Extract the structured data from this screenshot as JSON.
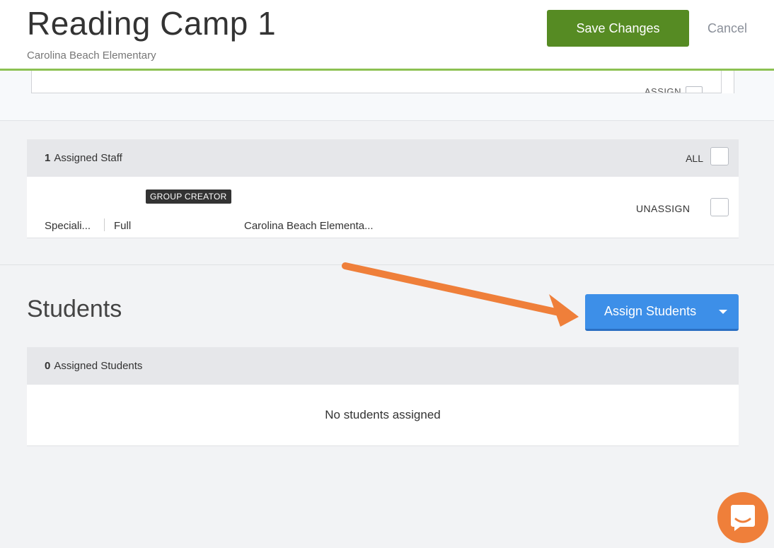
{
  "header": {
    "title": "Reading Camp 1",
    "subtitle": "Carolina Beach Elementary",
    "save_label": "Save Changes",
    "cancel_label": "Cancel"
  },
  "prev_section": {
    "assign_label": "ASSIGN"
  },
  "staff": {
    "count": "1",
    "header_label": "Assigned Staff",
    "all_label": "ALL",
    "rows": [
      {
        "badge": "GROUP CREATOR",
        "role": "Speciali...",
        "type": "Full",
        "school": "Carolina Beach Elementa...",
        "unassign_label": "UNASSIGN"
      }
    ]
  },
  "students": {
    "title": "Students",
    "assign_button_label": "Assign Students",
    "count": "0",
    "header_label": "Assigned Students",
    "empty_message": "No students assigned"
  },
  "colors": {
    "accent_green": "#568b23",
    "header_rule": "#8cc152",
    "primary_blue": "#3d8fe8",
    "annotation_orange": "#ef7f3a"
  },
  "icons": {
    "caret": "caret-down-icon",
    "chat": "chat-bubble-icon",
    "annotation": "arrow-annotation"
  }
}
